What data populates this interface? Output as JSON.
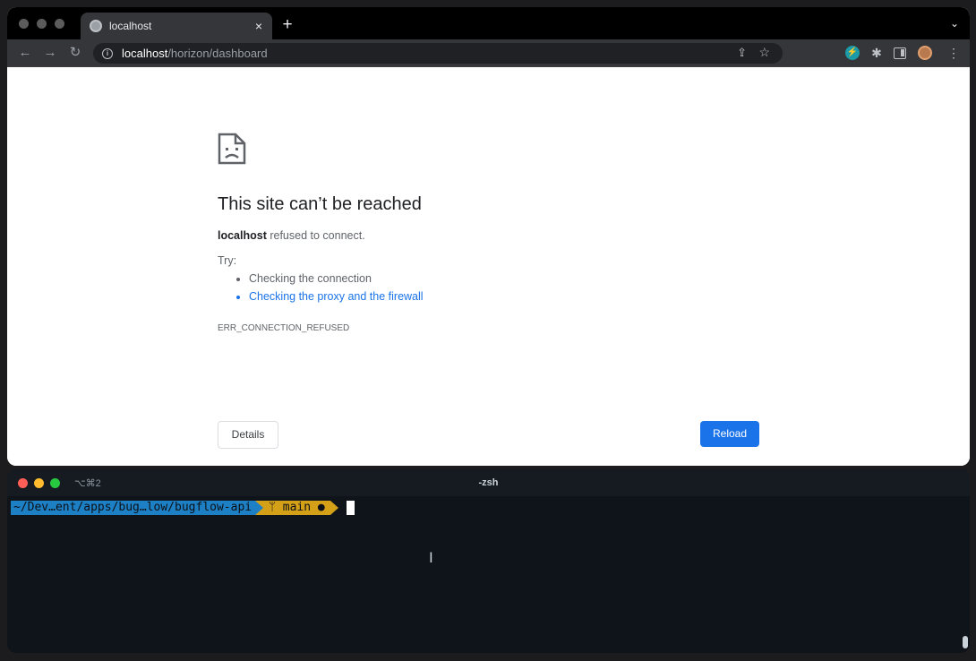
{
  "browser": {
    "tab": {
      "title": "localhost",
      "close": "×"
    },
    "new_tab": "+",
    "tab_menu": "⌄",
    "nav": {
      "back": "←",
      "forward": "→",
      "reload": "↻"
    },
    "omnibox": {
      "info": "i",
      "host": "localhost",
      "path": "/horizon/dashboard"
    },
    "actions": {
      "share": "⇪",
      "bookmark": "☆",
      "extension": "⚡",
      "puzzle": "✱",
      "menu": "⋮"
    }
  },
  "error_page": {
    "title": "This site can’t be reached",
    "host": "localhost",
    "message": " refused to connect.",
    "try_label": "Try:",
    "suggestions": [
      "Checking the connection",
      "Checking the proxy and the firewall"
    ],
    "code": "ERR_CONNECTION_REFUSED",
    "details_button": "Details",
    "reload_button": "Reload"
  },
  "terminal": {
    "shortcut": "⌥⌘2",
    "title": "-zsh",
    "prompt_path": "~/Dev…ent/apps/bug…low/bugflow-api",
    "git_branch": " main ●"
  },
  "colors": {
    "link": "#1a73e8",
    "reload_button": "#1a73e8",
    "prompt_path_bg": "#1d7fc4",
    "prompt_git_bg": "#d4a017"
  }
}
